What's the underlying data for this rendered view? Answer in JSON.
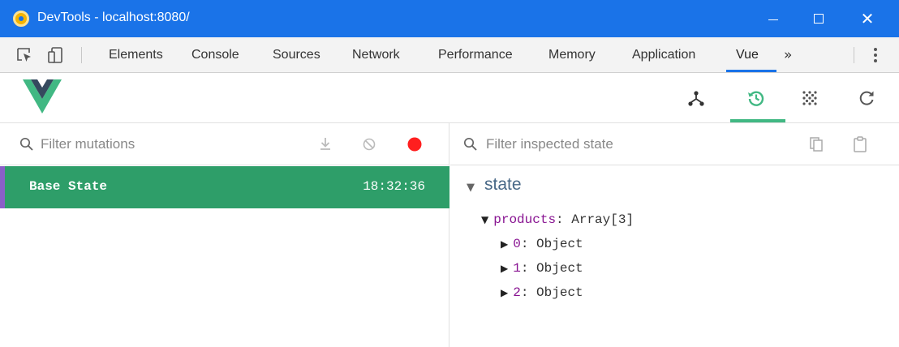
{
  "window": {
    "title": "DevTools - localhost:8080/",
    "minimize_glyph": "—",
    "maximize_glyph": "☐",
    "close_glyph": "✕"
  },
  "devtools_tabs": {
    "items": [
      {
        "label": "Elements"
      },
      {
        "label": "Console"
      },
      {
        "label": "Sources"
      },
      {
        "label": "Network"
      },
      {
        "label": "Performance"
      },
      {
        "label": "Memory"
      },
      {
        "label": "Application"
      },
      {
        "label": "Vue",
        "active": true
      }
    ],
    "more_glyph": "»",
    "icons": [
      "inspect-element-icon",
      "device-toolbar-icon",
      "more-options-icon"
    ]
  },
  "vue_toolbar": {
    "icons": [
      "components-icon",
      "vuex-history-icon",
      "events-icon",
      "refresh-icon"
    ],
    "active": "vuex-history-icon",
    "accent_color": "#41b883"
  },
  "mutations_panel": {
    "filter_placeholder": "Filter mutations",
    "actions": [
      "commit-all-icon",
      "revert-all-icon",
      "record-icon"
    ],
    "record_color": "#ff1f1f",
    "entries": [
      {
        "label": "Base State",
        "time": "18:32:36",
        "selected": true
      }
    ],
    "selected_color": "#2e9e69"
  },
  "state_panel": {
    "filter_placeholder": "Filter inspected state",
    "actions": [
      "copy-icon",
      "paste-icon"
    ],
    "section_title": "state",
    "tree": {
      "root_key": "products",
      "root_value": "Array[3]",
      "children": [
        {
          "key": "0",
          "value": "Object"
        },
        {
          "key": "1",
          "value": "Object"
        },
        {
          "key": "2",
          "value": "Object"
        }
      ]
    }
  }
}
